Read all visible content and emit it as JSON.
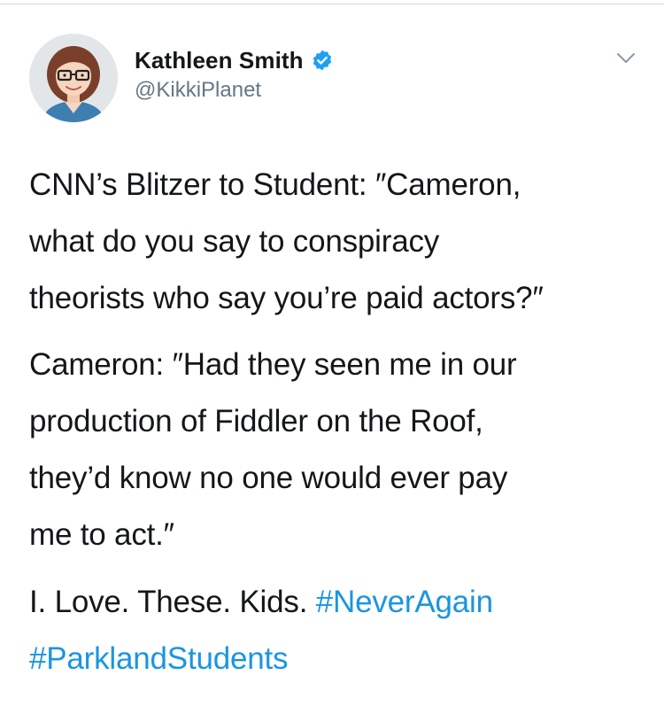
{
  "tweet": {
    "author": {
      "display_name": "Kathleen Smith",
      "handle": "@KikkiPlanet",
      "verified": true,
      "avatar": "avatar-cartoon-woman-glasses"
    },
    "icons": {
      "verified": "verified-badge-icon",
      "menu": "chevron-down-icon"
    },
    "colors": {
      "text": "#14171a",
      "secondary": "#657786",
      "link": "#1b95e0",
      "verified": "#1da1f2"
    },
    "paragraphs": [
      {
        "lines": [
          "CNN’s Blitzer to Student: ″Cameron,",
          "what do you say to conspiracy",
          "theorists who say you’re paid actors?″"
        ]
      },
      {
        "lines": [
          "Cameron: ″Had they seen me in our",
          "production of Fiddler on the Roof,",
          "they’d know no one would ever pay",
          "me to act.″"
        ]
      }
    ],
    "closing": {
      "text": "I. Love. These. Kids. ",
      "hashtags": [
        "#NeverAgain",
        "#ParklandStudents"
      ]
    }
  }
}
